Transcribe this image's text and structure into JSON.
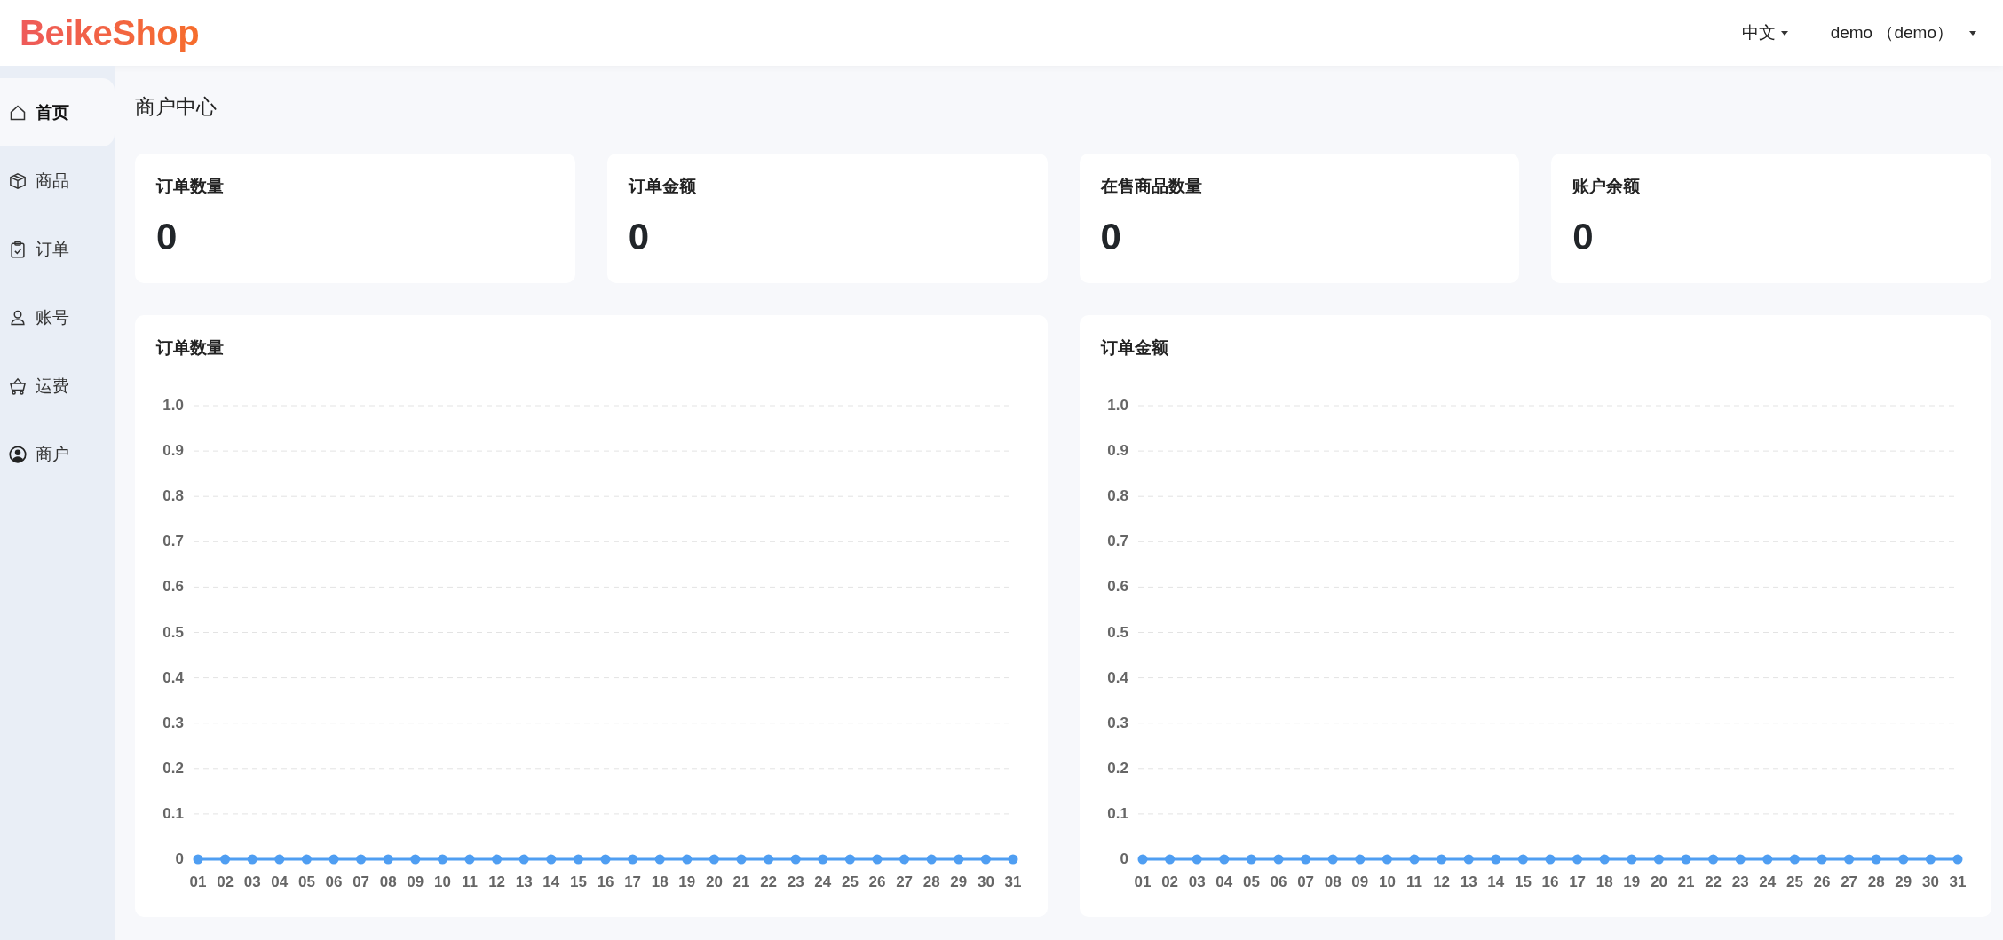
{
  "header": {
    "logo": "BeikeShop",
    "language": "中文",
    "user": "demo （demo）"
  },
  "sidebar": {
    "items": [
      {
        "label": "首页",
        "selected": true
      },
      {
        "label": "商品",
        "selected": false
      },
      {
        "label": "订单",
        "selected": false
      },
      {
        "label": "账号",
        "selected": false
      },
      {
        "label": "运费",
        "selected": false
      },
      {
        "label": "商户",
        "selected": false
      }
    ]
  },
  "page_title": "商户中心",
  "stats": [
    {
      "label": "订单数量",
      "value": "0"
    },
    {
      "label": "订单金额",
      "value": "0"
    },
    {
      "label": "在售商品数量",
      "value": "0"
    },
    {
      "label": "账户余额",
      "value": "0"
    }
  ],
  "charts": [
    {
      "title": "订单数量",
      "chart_data": {
        "type": "line",
        "categories": [
          "01",
          "02",
          "03",
          "04",
          "05",
          "06",
          "07",
          "08",
          "09",
          "10",
          "11",
          "12",
          "13",
          "14",
          "15",
          "16",
          "17",
          "18",
          "19",
          "20",
          "21",
          "22",
          "23",
          "24",
          "25",
          "26",
          "27",
          "28",
          "29",
          "30",
          "31"
        ],
        "series": [
          {
            "color": "#4f9ef2",
            "marker": true,
            "values": [
              0,
              0,
              0,
              0,
              0,
              0,
              0,
              0,
              0,
              0,
              0,
              0,
              0,
              0,
              0,
              0,
              0,
              0,
              0,
              0,
              0,
              0,
              0,
              0,
              0,
              0,
              0,
              0,
              0,
              0,
              0
            ]
          }
        ],
        "ylim": [
          0,
          1
        ],
        "grid": true,
        "yticks": [
          0,
          0.1,
          0.2,
          0.3,
          0.4,
          0.5,
          0.6,
          0.7,
          0.8,
          0.9,
          {
            "value": 1,
            "label": "1.0"
          }
        ]
      }
    },
    {
      "title": "订单金额",
      "chart_data": {
        "type": "line",
        "categories": [
          "01",
          "02",
          "03",
          "04",
          "05",
          "06",
          "07",
          "08",
          "09",
          "10",
          "11",
          "12",
          "13",
          "14",
          "15",
          "16",
          "17",
          "18",
          "19",
          "20",
          "21",
          "22",
          "23",
          "24",
          "25",
          "26",
          "27",
          "28",
          "29",
          "30",
          "31"
        ],
        "series": [
          {
            "color": "#4f9ef2",
            "marker": true,
            "values": [
              0,
              0,
              0,
              0,
              0,
              0,
              0,
              0,
              0,
              0,
              0,
              0,
              0,
              0,
              0,
              0,
              0,
              0,
              0,
              0,
              0,
              0,
              0,
              0,
              0,
              0,
              0,
              0,
              0,
              0,
              0
            ]
          }
        ],
        "ylim": [
          0,
          1
        ],
        "grid": true,
        "yticks": [
          0,
          0.1,
          0.2,
          0.3,
          0.4,
          0.5,
          0.6,
          0.7,
          0.8,
          0.9,
          {
            "value": 1,
            "label": "1.0"
          }
        ]
      }
    }
  ]
}
